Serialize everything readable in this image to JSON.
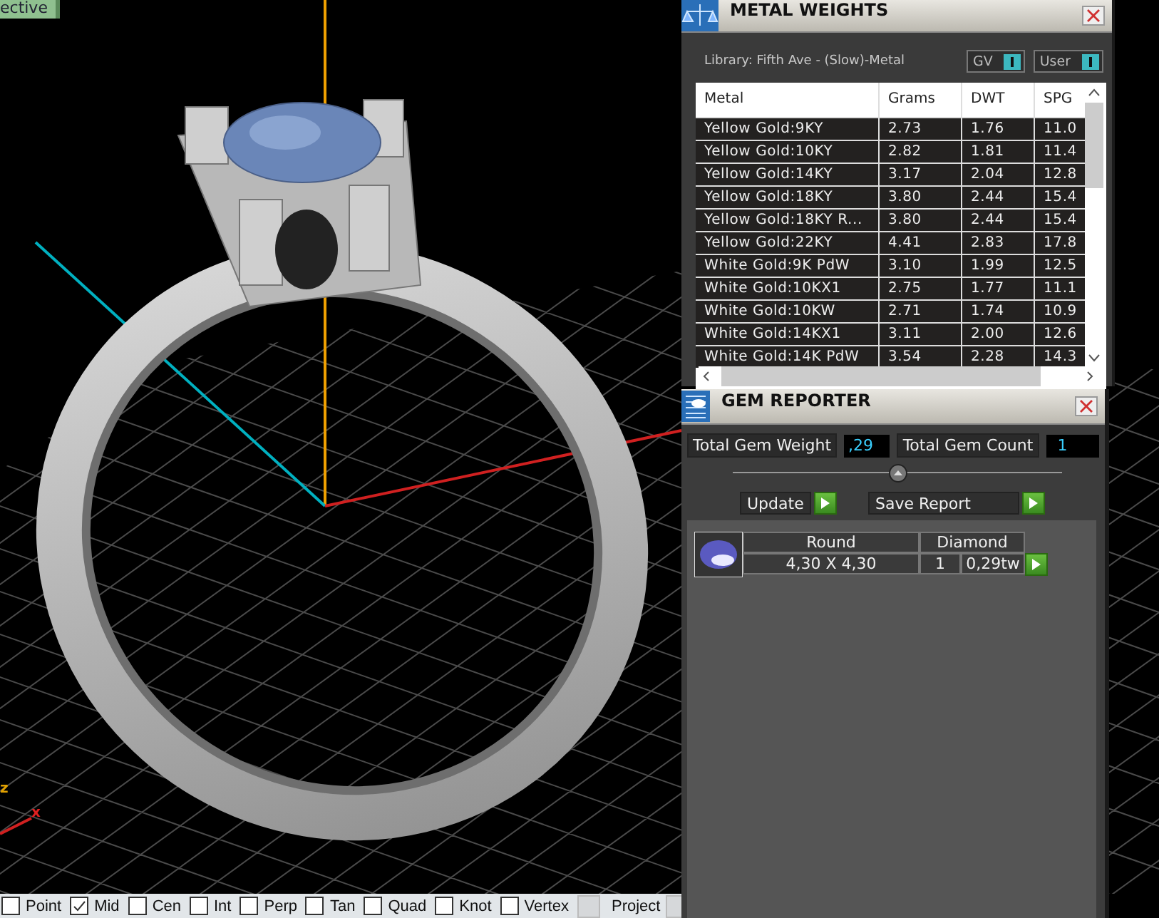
{
  "viewport": {
    "tab_label": "ective",
    "axis_labels": [
      "z",
      "x"
    ]
  },
  "metal_weights": {
    "title": "METAL WEIGHTS",
    "library": "Library: Fifth Ave - (Slow)-Metal",
    "toggles": [
      {
        "label": "GV",
        "on": true
      },
      {
        "label": "User",
        "on": true
      }
    ],
    "columns": [
      "Metal",
      "Grams",
      "DWT",
      "SPG"
    ],
    "rows": [
      [
        "Yellow Gold:9KY",
        "2.73",
        "1.76",
        "11.0"
      ],
      [
        "Yellow Gold:10KY",
        "2.82",
        "1.81",
        "11.4"
      ],
      [
        "Yellow Gold:14KY",
        "3.17",
        "2.04",
        "12.8"
      ],
      [
        "Yellow Gold:18KY",
        "3.80",
        "2.44",
        "15.4"
      ],
      [
        "Yellow Gold:18KY R...",
        "3.80",
        "2.44",
        "15.4"
      ],
      [
        "Yellow Gold:22KY",
        "4.41",
        "2.83",
        "17.8"
      ],
      [
        "White Gold:9K PdW",
        "3.10",
        "1.99",
        "12.5"
      ],
      [
        "White Gold:10KX1",
        "2.75",
        "1.77",
        "11.1"
      ],
      [
        "White Gold:10KW",
        "2.71",
        "1.74",
        "10.9"
      ],
      [
        "White Gold:14KX1",
        "3.11",
        "2.00",
        "12.6"
      ],
      [
        "White Gold:14K PdW",
        "3.54",
        "2.28",
        "14.3"
      ]
    ]
  },
  "gem_reporter": {
    "title": "GEM REPORTER",
    "total_weight_label": "Total Gem Weight",
    "total_weight": ",29",
    "total_count_label": "Total Gem Count",
    "total_count": "1",
    "buttons": [
      "Update",
      "Save Report"
    ],
    "gems": [
      {
        "shape": "Round",
        "type": "Diamond",
        "size": "4,30 X 4,30",
        "count": "1",
        "weight": "0,29tw"
      }
    ]
  },
  "snap_bar": [
    {
      "kind": "checkbox",
      "label": "Point",
      "checked": false
    },
    {
      "kind": "checkbox",
      "label": "Mid",
      "checked": true
    },
    {
      "kind": "checkbox",
      "label": "Cen",
      "checked": false
    },
    {
      "kind": "checkbox",
      "label": "Int",
      "checked": false
    },
    {
      "kind": "checkbox",
      "label": "Perp",
      "checked": false
    },
    {
      "kind": "checkbox",
      "label": "Tan",
      "checked": false
    },
    {
      "kind": "checkbox",
      "label": "Quad",
      "checked": false
    },
    {
      "kind": "checkbox",
      "label": "Knot",
      "checked": false
    },
    {
      "kind": "checkbox",
      "label": "Vertex",
      "checked": false
    },
    {
      "kind": "button",
      "label": "Project"
    }
  ]
}
